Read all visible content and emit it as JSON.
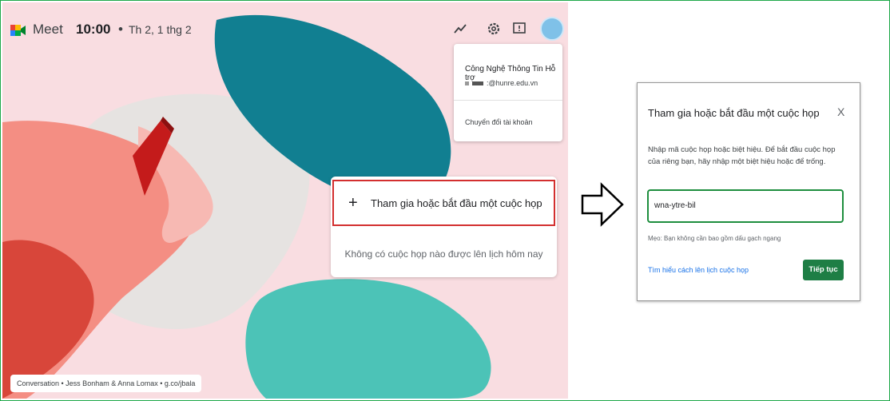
{
  "meet": {
    "app_name": "Meet",
    "time": "10:00",
    "separator": "•",
    "date": "Th 2, 1 thg 2",
    "account": {
      "name": "Công Nghệ Thông Tin Hỗ trợ",
      "email": ":@hunre.edu.vn",
      "switch_label": "Chuyển đổi tài khoản"
    },
    "join_label": "Tham gia hoặc bắt đầu một cuộc họp",
    "join_icon": "+",
    "no_meetings": "Không có cuộc họp nào được lên lịch hôm nay",
    "credit": "Conversation • Jess Bonham & Anna Lomax • g.co/jbala"
  },
  "dialog": {
    "title": "Tham gia hoặc bắt đầu một cuộc họp",
    "close": "X",
    "description": "Nhập mã cuộc họp hoặc biệt hiệu. Để bắt đầu cuộc họp của riêng bạn, hãy nhập một biệt hiệu hoặc để trống.",
    "input_value": "wna-ytre-bil",
    "hint": "Mẹo: Bạn không cần bao gồm dấu gạch ngang",
    "learn_link": "Tìm hiểu cách lên lịch cuộc họp",
    "continue_label": "Tiếp tục"
  },
  "colors": {
    "accent_green": "#1e7e45",
    "highlight_red": "#d32f2f",
    "frame_green": "#1fa84a",
    "link_blue": "#1a73e8"
  },
  "icons": [
    "meet-logo-icon",
    "activity-icon",
    "settings-gear-icon",
    "feedback-icon",
    "account-avatar-icon",
    "plus-icon",
    "arrow-right-icon",
    "close-icon"
  ]
}
